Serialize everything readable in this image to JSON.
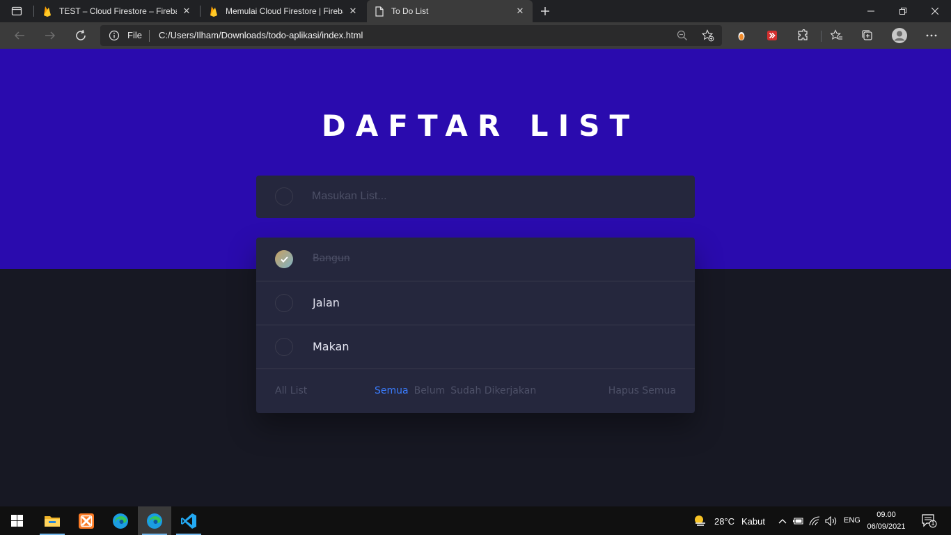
{
  "browser": {
    "tabs": [
      {
        "title": "TEST – Cloud Firestore – Firebase",
        "icon": "firebase-icon"
      },
      {
        "title": "Memulai Cloud Firestore  |  Firebase",
        "icon": "firebase-icon"
      },
      {
        "title": "To Do List",
        "icon": "page-icon",
        "active": true
      }
    ],
    "address": {
      "scheme_label": "File",
      "url": "C:/Users/Ilham/Downloads/todo-aplikasi/index.html"
    }
  },
  "app": {
    "title": "DAFTAR LIST",
    "input_placeholder": "Masukan List...",
    "todos": [
      {
        "text": "Bangun",
        "completed": true
      },
      {
        "text": "Jalan",
        "completed": false
      },
      {
        "text": "Makan",
        "completed": false
      }
    ],
    "footer": {
      "count_label": "All List",
      "filters": [
        "Semua",
        "Belum",
        "Sudah Dikerjakan"
      ],
      "active_filter": "Semua",
      "clear_label": "Hapus Semua"
    },
    "colors": {
      "hero": "#2a0bae",
      "background": "#171823",
      "card": "#25273d",
      "active_filter": "#3a7cfd"
    }
  },
  "taskbar": {
    "weather": {
      "temp": "28°C",
      "condition": "Kabut"
    },
    "language": "ENG",
    "time": "09.00",
    "date": "06/09/2021",
    "notification_count": "1"
  }
}
